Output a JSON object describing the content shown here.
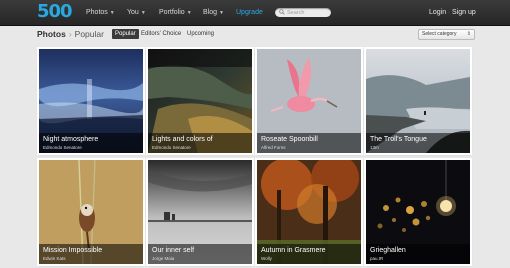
{
  "brand": {
    "logo_text": "500"
  },
  "nav": {
    "photos": "Photos",
    "you": "You",
    "portfolio": "Portfolio",
    "blog": "Blog",
    "upgrade": "Upgrade",
    "search_placeholder": "Search",
    "login": "Login",
    "signup": "Sign up"
  },
  "breadcrumb": {
    "root": "Photos",
    "separator": "›",
    "current": "Popular"
  },
  "tabs": [
    "Popular",
    "Editors' Choice",
    "Upcoming"
  ],
  "category_select": {
    "selected": "Select category"
  },
  "photos": [
    {
      "title": "Night atmosphere",
      "author": "Edmondo Senatore"
    },
    {
      "title": "Lights and colors of",
      "author": "Edmondo Senatore"
    },
    {
      "title": "Roseate Spoonbill",
      "author": "Alfred Forns"
    },
    {
      "title": "The Troll's Tongue",
      "author": "13m"
    },
    {
      "title": "Mission Impossible",
      "author": "Edwin Kats"
    },
    {
      "title": "Our inner self",
      "author": "Jorge Maia"
    },
    {
      "title": "Autumn in Grasmere",
      "author": "Wolly"
    },
    {
      "title": "Grieghallen",
      "author": "pau.tR"
    }
  ],
  "colors": {
    "accent": "#2aa9e0",
    "topbar": "#2e2e2e",
    "background": "#e8e8e8"
  },
  "icons": {
    "search": "search-icon",
    "caret": "chevron-down-icon"
  }
}
